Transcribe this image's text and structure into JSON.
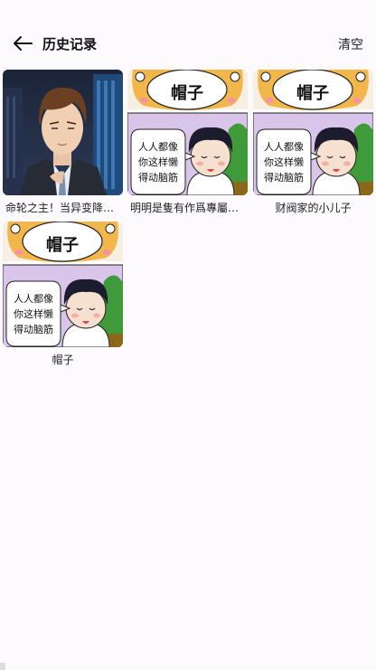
{
  "header": {
    "title": "历史记录",
    "clear_label": "清空",
    "back_icon": "arrow-left-icon"
  },
  "history": [
    {
      "title": "命轮之主！当异变降…",
      "cover": "suited-man-portrait"
    },
    {
      "title": "明明是隻有作爲專屬…",
      "cover": "hat-comic-panel",
      "cover_title": "帽子",
      "cover_bubble": [
        "人人都像",
        "你这样懒",
        "得动脑筋"
      ]
    },
    {
      "title": "财阀家的小儿子",
      "cover": "hat-comic-panel",
      "cover_title": "帽子",
      "cover_bubble": [
        "人人都像",
        "你这样懒",
        "得动脑筋"
      ]
    },
    {
      "title": "帽子",
      "cover": "hat-comic-panel",
      "cover_title": "帽子",
      "cover_bubble": [
        "人人都像",
        "你这样懒",
        "得动脑筋"
      ]
    }
  ],
  "colors": {
    "background": "#fdfafd",
    "comic_lavender": "#d9c4ea",
    "comic_tiger_orange": "#f2b64a"
  }
}
